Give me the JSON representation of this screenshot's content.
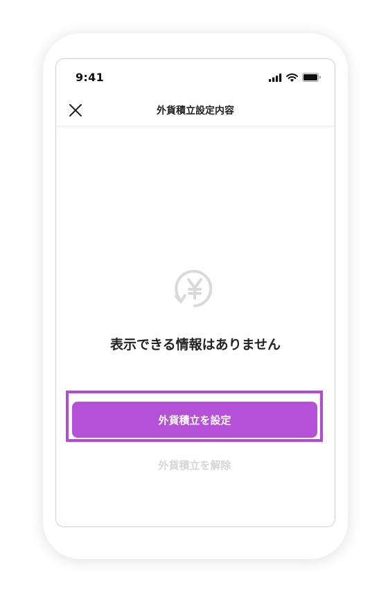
{
  "status_bar": {
    "time": "9:41",
    "icons": [
      "cellular-signal-icon",
      "wifi-icon",
      "battery-icon"
    ]
  },
  "header": {
    "title": "外貨積立設定内容",
    "close_icon": "close-icon"
  },
  "empty_state": {
    "icon": "yen-refresh-icon",
    "message": "表示できる情報はありません"
  },
  "actions": {
    "primary_label": "外貨積立を設定",
    "secondary_label": "外貨積立を解除"
  },
  "colors": {
    "accent": "#b550d8",
    "highlight": "#b548d5",
    "disabled_text": "#d6d6d6",
    "icon_gray": "#d9d9d9"
  }
}
